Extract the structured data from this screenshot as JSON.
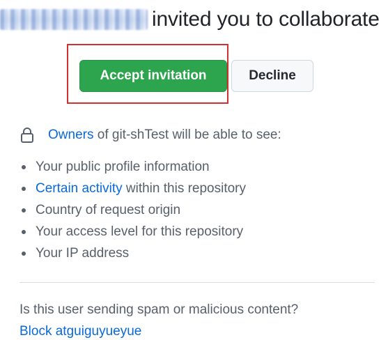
{
  "header": {
    "title_suffix": "invited you to collaborate"
  },
  "actions": {
    "accept_label": "Accept invitation",
    "decline_label": "Decline"
  },
  "visibility": {
    "owners_link": "Owners",
    "repo_text": "of git-shTest will be able to see:",
    "icon": "lock-icon"
  },
  "permissions": [
    {
      "text": "Your public profile information"
    },
    {
      "link": "Certain activity",
      "text": "within this repository"
    },
    {
      "text": "Country of request origin"
    },
    {
      "text": "Your access level for this repository"
    },
    {
      "text": "Your IP address"
    }
  ],
  "footer": {
    "spam_question": "Is this user sending spam or malicious content?",
    "block_link": "Block atguiguyueyue"
  },
  "colors": {
    "accept_bg": "#2da44e",
    "link": "#0969da",
    "highlight": "#d32f2f"
  }
}
